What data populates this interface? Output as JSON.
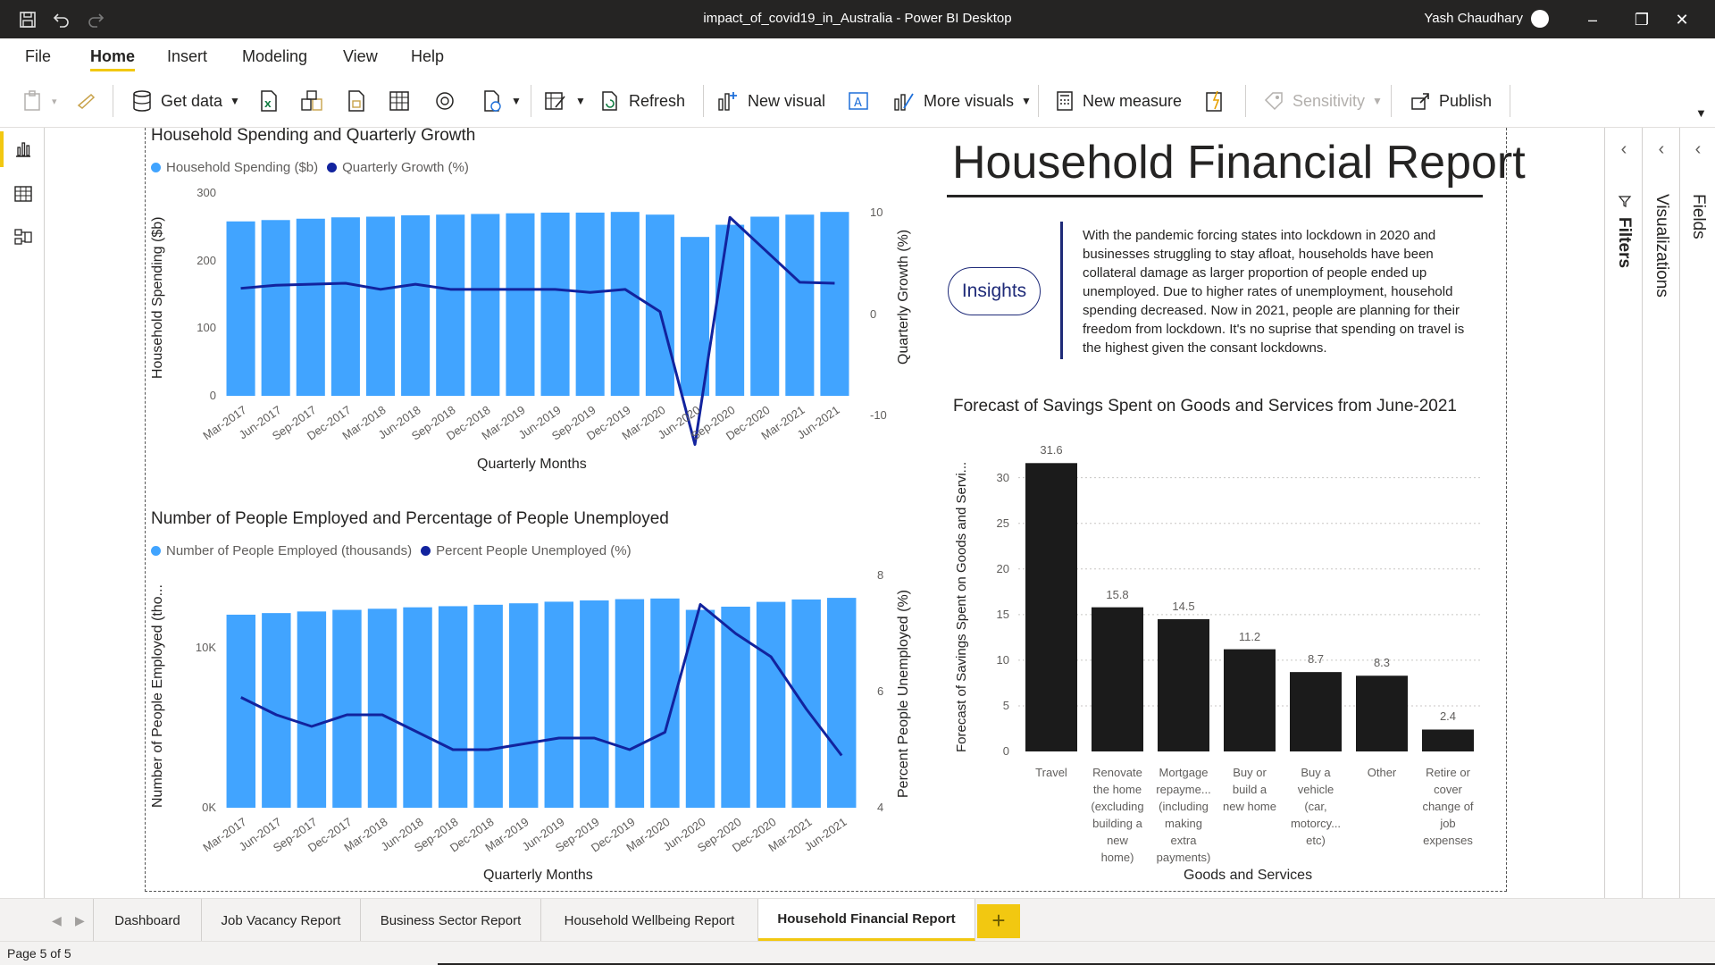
{
  "window": {
    "title": "impact_of_covid19_in_Australia - Power BI Desktop",
    "user": "Yash Chaudhary"
  },
  "menu": {
    "tabs": [
      "File",
      "Home",
      "Insert",
      "Modeling",
      "View",
      "Help"
    ],
    "active": "Home"
  },
  "ribbon": {
    "get_data": "Get data",
    "refresh": "Refresh",
    "new_visual": "New visual",
    "more_visuals": "More visuals",
    "new_measure": "New measure",
    "sensitivity": "Sensitivity",
    "publish": "Publish"
  },
  "panes": {
    "filters": "Filters",
    "visualizations": "Visualizations",
    "fields": "Fields"
  },
  "report": {
    "title": "Household Financial Report",
    "insights_button": "Insights",
    "insight_text": "With the pandemic forcing states into lockdown in 2020 and businesses struggling to stay afloat, households have been collateral damage as larger proportion of people ended up unemployed. Due to higher rates of unemployment, household spending decreased. Now in 2021, people are planning for their freedom from lockdown. It's no suprise that spending on travel is the highest given the consant lockdowns."
  },
  "chart_data": [
    {
      "type": "bar",
      "combo_line": true,
      "title": "Household Spending and Quarterly Growth",
      "xlabel": "Quarterly Months",
      "ylabel": "Household Spending ($b)",
      "y2label": "Quarterly Growth (%)",
      "categories": [
        "Mar-2017",
        "Jun-2017",
        "Sep-2017",
        "Dec-2017",
        "Mar-2018",
        "Jun-2018",
        "Sep-2018",
        "Dec-2018",
        "Mar-2019",
        "Jun-2019",
        "Sep-2019",
        "Dec-2019",
        "Mar-2020",
        "Jun-2020",
        "Sep-2020",
        "Dec-2020",
        "Mar-2021",
        "Jun-2021"
      ],
      "ylim": [
        0,
        300
      ],
      "yticks": [
        "300",
        "200",
        "100",
        "0"
      ],
      "y2lim": [
        -10,
        10
      ],
      "y2ticks": [
        "10",
        "0",
        "-10"
      ],
      "series": [
        {
          "name": "Household Spending ($b)",
          "kind": "bar",
          "color": "#41a4ff",
          "values": [
            258,
            260,
            262,
            264,
            265,
            267,
            268,
            269,
            270,
            271,
            271,
            272,
            268,
            235,
            253,
            265,
            268,
            272
          ]
        },
        {
          "name": "Quarterly Growth (%)",
          "kind": "line",
          "axis": "secondary",
          "color": "#12239e",
          "values": [
            0.6,
            0.9,
            1.0,
            1.1,
            0.5,
            1.0,
            0.5,
            0.5,
            0.5,
            0.5,
            0.2,
            0.5,
            -1.7,
            -14.8,
            7.6,
            4.4,
            1.2,
            1.1
          ]
        }
      ]
    },
    {
      "type": "bar",
      "combo_line": true,
      "title": "Number of People Employed and Percentage of People Unemployed",
      "xlabel": "Quarterly Months",
      "ylabel": "Number of People Employed (tho...",
      "y2label": "Percent People Unemployed (%)",
      "categories": [
        "Mar-2017",
        "Jun-2017",
        "Sep-2017",
        "Dec-2017",
        "Mar-2018",
        "Jun-2018",
        "Sep-2018",
        "Dec-2018",
        "Mar-2019",
        "Jun-2019",
        "Sep-2019",
        "Dec-2019",
        "Mar-2020",
        "Jun-2020",
        "Sep-2020",
        "Dec-2020",
        "Mar-2021",
        "Jun-2021"
      ],
      "ylim": [
        0,
        14500
      ],
      "yticks": [
        "10K",
        "0K"
      ],
      "y2lim": [
        4,
        8
      ],
      "y2ticks": [
        "8",
        "6",
        "4"
      ],
      "series": [
        {
          "name": "Number of People Employed (thousands)",
          "kind": "bar",
          "color": "#41a4ff",
          "values": [
            12050,
            12150,
            12250,
            12350,
            12420,
            12510,
            12580,
            12670,
            12760,
            12860,
            12940,
            13020,
            13060,
            12350,
            12550,
            12850,
            13000,
            13100
          ]
        },
        {
          "name": "Percent People Unemployed (%)",
          "kind": "line",
          "axis": "secondary",
          "color": "#12239e",
          "values": [
            5.9,
            5.6,
            5.4,
            5.6,
            5.6,
            5.3,
            5.0,
            5.0,
            5.1,
            5.2,
            5.2,
            5.0,
            5.3,
            7.5,
            7.0,
            6.6,
            5.7,
            4.9
          ]
        }
      ]
    },
    {
      "type": "bar",
      "title": "Forecast of Savings Spent on Goods and Services from June-2021",
      "xlabel": "Goods and Services",
      "ylabel": "Forecast of Savings Spent on Goods and Servi...",
      "ylim": [
        0,
        33
      ],
      "yticks": [
        "30",
        "25",
        "20",
        "15",
        "10",
        "5",
        "0"
      ],
      "categories": [
        "Travel",
        "Renovate the home (excluding building a new home)",
        "Mortgage repayme... (including making extra payments)",
        "Buy or build a new home",
        "Buy a vehicle (car, motorcy... etc)",
        "Other",
        "Retire or cover change of job expenses"
      ],
      "category_lines": [
        [
          "Travel"
        ],
        [
          "Renovate",
          "the home",
          "(excluding",
          "building a",
          "new",
          "home)"
        ],
        [
          "Mortgage",
          "repayme...",
          "(including",
          "making",
          "extra",
          "payments)"
        ],
        [
          "Buy or",
          "build a",
          "new home"
        ],
        [
          "Buy a",
          "vehicle",
          "(car,",
          "motorcy...",
          "etc)"
        ],
        [
          "Other"
        ],
        [
          "Retire or",
          "cover",
          "change of",
          "job",
          "expenses"
        ]
      ],
      "values": [
        31.6,
        15.8,
        14.5,
        11.2,
        8.7,
        8.3,
        2.4
      ],
      "value_labels": [
        "31.6",
        "15.8",
        "14.5",
        "11.2",
        "8.7",
        "8.3",
        "2.4"
      ],
      "color": "#1b1b1b"
    }
  ],
  "page_tabs": {
    "tabs": [
      "Dashboard",
      "Job Vacancy Report",
      "Business Sector Report",
      "Household Wellbeing Report",
      "Household Financial Report"
    ],
    "active": "Household Financial Report",
    "add": "+"
  },
  "status": {
    "page": "Page 5 of 5"
  },
  "colors": {
    "accent": "#f2c811",
    "bar_blue": "#41a4ff",
    "line_navy": "#12239e",
    "titlebar": "#252423"
  }
}
